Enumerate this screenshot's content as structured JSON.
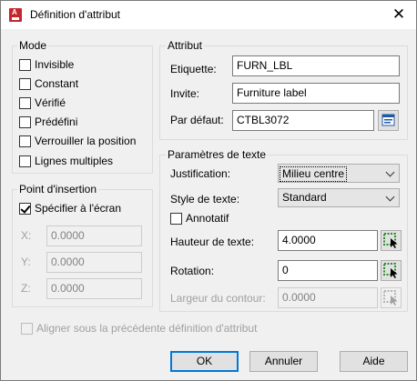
{
  "window": {
    "title": "Définition d'attribut",
    "close": "✕"
  },
  "mode": {
    "label": "Mode",
    "items": [
      {
        "label": "Invisible",
        "checked": false
      },
      {
        "label": "Constant",
        "checked": false
      },
      {
        "label": "Vérifié",
        "checked": false
      },
      {
        "label": "Prédéfini",
        "checked": false
      },
      {
        "label": "Verrouiller la position",
        "checked": false
      },
      {
        "label": "Lignes multiples",
        "checked": false
      }
    ]
  },
  "insertion": {
    "label": "Point d'insertion",
    "specify_label": "Spécifier à l'écran",
    "specify_checked": true,
    "x_label": "X:",
    "x_value": "0.0000",
    "y_label": "Y:",
    "y_value": "0.0000",
    "z_label": "Z:",
    "z_value": "0.0000"
  },
  "attribute": {
    "label": "Attribut",
    "tag_label": "Etiquette:",
    "tag_value": "FURN_LBL",
    "prompt_label": "Invite:",
    "prompt_value": "Furniture label",
    "default_label": "Par défaut:",
    "default_value": "CTBL3072"
  },
  "text": {
    "label": "Paramètres de texte",
    "justification_label": "Justification:",
    "justification_value": "Milieu centre",
    "style_label": "Style de texte:",
    "style_value": "Standard",
    "annotative_label": "Annotatif",
    "annotative_checked": false,
    "height_label": "Hauteur de texte:",
    "height_value": "4.0000",
    "rotation_label": "Rotation:",
    "rotation_value": "0",
    "width_label": "Largeur du contour:",
    "width_value": "0.0000"
  },
  "align": {
    "label": "Aligner sous la précédente définition d'attribut",
    "checked": false
  },
  "buttons": {
    "ok": "OK",
    "cancel": "Annuler",
    "help": "Aide"
  },
  "colors": {
    "accent": "#0078d7",
    "icon_red": "#c3262b",
    "pick_green": "#2e8b2e"
  }
}
